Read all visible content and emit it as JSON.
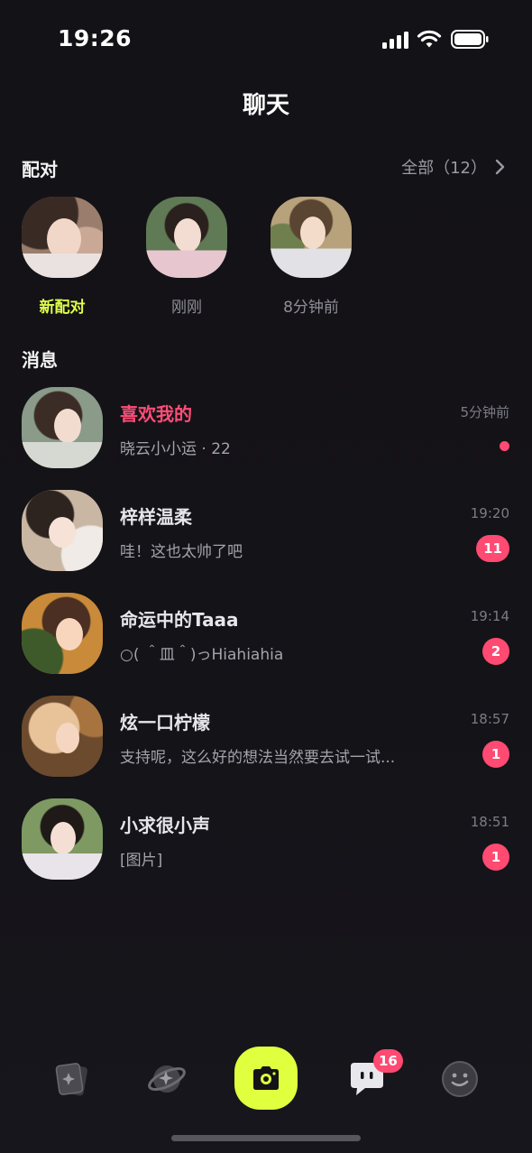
{
  "status_bar": {
    "time": "19:26"
  },
  "header": {
    "title": "聊天"
  },
  "matches": {
    "title": "配对",
    "see_all": "全部（12）",
    "items": [
      {
        "label": "新配对",
        "avatar": "avatar-photo"
      },
      {
        "label": "刚刚",
        "avatar": "avatar-photo"
      },
      {
        "label": "8分钟前",
        "avatar": "avatar-photo"
      }
    ]
  },
  "messages": {
    "title": "消息",
    "items": [
      {
        "name": "喜欢我的",
        "preview": "晓云小小运 · 22",
        "time": "5分钟前",
        "unread": "",
        "indicator": "dot"
      },
      {
        "name": "梓样温柔",
        "preview": "哇！这也太帅了吧",
        "time": "19:20",
        "unread": "11",
        "indicator": "badge"
      },
      {
        "name": "命运中的Taaa",
        "preview": "○( ＾皿＾)っHiahiahia",
        "time": "19:14",
        "unread": "2",
        "indicator": "badge"
      },
      {
        "name": "炫一口柠檬",
        "preview": "支持呢，这么好的想法当然要去试一试...",
        "time": "18:57",
        "unread": "1",
        "indicator": "badge"
      },
      {
        "name": "小求很小声",
        "preview": "[图片]",
        "time": "18:51",
        "unread": "1",
        "indicator": "badge"
      }
    ]
  },
  "bottom_nav": {
    "items": [
      {
        "icon": "cards-icon"
      },
      {
        "icon": "planet-icon"
      },
      {
        "icon": "camera-icon"
      },
      {
        "icon": "chat-icon",
        "badge": "16"
      },
      {
        "icon": "smiley-icon"
      }
    ]
  },
  "colors": {
    "accent": "#e0ff3e",
    "pink": "#ff4a72",
    "background": "#131216"
  }
}
